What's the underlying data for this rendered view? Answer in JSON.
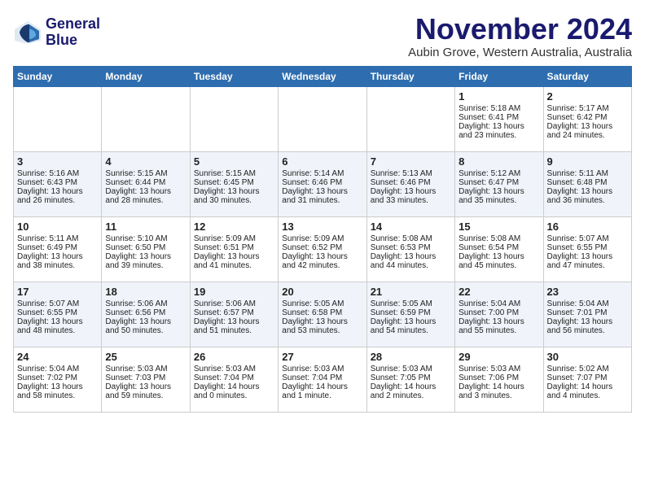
{
  "logo": {
    "line1": "General",
    "line2": "Blue"
  },
  "title": "November 2024",
  "location": "Aubin Grove, Western Australia, Australia",
  "days_header": [
    "Sunday",
    "Monday",
    "Tuesday",
    "Wednesday",
    "Thursday",
    "Friday",
    "Saturday"
  ],
  "weeks": [
    [
      {
        "day": "",
        "info": ""
      },
      {
        "day": "",
        "info": ""
      },
      {
        "day": "",
        "info": ""
      },
      {
        "day": "",
        "info": ""
      },
      {
        "day": "",
        "info": ""
      },
      {
        "day": "1",
        "info": "Sunrise: 5:18 AM\nSunset: 6:41 PM\nDaylight: 13 hours\nand 23 minutes."
      },
      {
        "day": "2",
        "info": "Sunrise: 5:17 AM\nSunset: 6:42 PM\nDaylight: 13 hours\nand 24 minutes."
      }
    ],
    [
      {
        "day": "3",
        "info": "Sunrise: 5:16 AM\nSunset: 6:43 PM\nDaylight: 13 hours\nand 26 minutes."
      },
      {
        "day": "4",
        "info": "Sunrise: 5:15 AM\nSunset: 6:44 PM\nDaylight: 13 hours\nand 28 minutes."
      },
      {
        "day": "5",
        "info": "Sunrise: 5:15 AM\nSunset: 6:45 PM\nDaylight: 13 hours\nand 30 minutes."
      },
      {
        "day": "6",
        "info": "Sunrise: 5:14 AM\nSunset: 6:46 PM\nDaylight: 13 hours\nand 31 minutes."
      },
      {
        "day": "7",
        "info": "Sunrise: 5:13 AM\nSunset: 6:46 PM\nDaylight: 13 hours\nand 33 minutes."
      },
      {
        "day": "8",
        "info": "Sunrise: 5:12 AM\nSunset: 6:47 PM\nDaylight: 13 hours\nand 35 minutes."
      },
      {
        "day": "9",
        "info": "Sunrise: 5:11 AM\nSunset: 6:48 PM\nDaylight: 13 hours\nand 36 minutes."
      }
    ],
    [
      {
        "day": "10",
        "info": "Sunrise: 5:11 AM\nSunset: 6:49 PM\nDaylight: 13 hours\nand 38 minutes."
      },
      {
        "day": "11",
        "info": "Sunrise: 5:10 AM\nSunset: 6:50 PM\nDaylight: 13 hours\nand 39 minutes."
      },
      {
        "day": "12",
        "info": "Sunrise: 5:09 AM\nSunset: 6:51 PM\nDaylight: 13 hours\nand 41 minutes."
      },
      {
        "day": "13",
        "info": "Sunrise: 5:09 AM\nSunset: 6:52 PM\nDaylight: 13 hours\nand 42 minutes."
      },
      {
        "day": "14",
        "info": "Sunrise: 5:08 AM\nSunset: 6:53 PM\nDaylight: 13 hours\nand 44 minutes."
      },
      {
        "day": "15",
        "info": "Sunrise: 5:08 AM\nSunset: 6:54 PM\nDaylight: 13 hours\nand 45 minutes."
      },
      {
        "day": "16",
        "info": "Sunrise: 5:07 AM\nSunset: 6:55 PM\nDaylight: 13 hours\nand 47 minutes."
      }
    ],
    [
      {
        "day": "17",
        "info": "Sunrise: 5:07 AM\nSunset: 6:55 PM\nDaylight: 13 hours\nand 48 minutes."
      },
      {
        "day": "18",
        "info": "Sunrise: 5:06 AM\nSunset: 6:56 PM\nDaylight: 13 hours\nand 50 minutes."
      },
      {
        "day": "19",
        "info": "Sunrise: 5:06 AM\nSunset: 6:57 PM\nDaylight: 13 hours\nand 51 minutes."
      },
      {
        "day": "20",
        "info": "Sunrise: 5:05 AM\nSunset: 6:58 PM\nDaylight: 13 hours\nand 53 minutes."
      },
      {
        "day": "21",
        "info": "Sunrise: 5:05 AM\nSunset: 6:59 PM\nDaylight: 13 hours\nand 54 minutes."
      },
      {
        "day": "22",
        "info": "Sunrise: 5:04 AM\nSunset: 7:00 PM\nDaylight: 13 hours\nand 55 minutes."
      },
      {
        "day": "23",
        "info": "Sunrise: 5:04 AM\nSunset: 7:01 PM\nDaylight: 13 hours\nand 56 minutes."
      }
    ],
    [
      {
        "day": "24",
        "info": "Sunrise: 5:04 AM\nSunset: 7:02 PM\nDaylight: 13 hours\nand 58 minutes."
      },
      {
        "day": "25",
        "info": "Sunrise: 5:03 AM\nSunset: 7:03 PM\nDaylight: 13 hours\nand 59 minutes."
      },
      {
        "day": "26",
        "info": "Sunrise: 5:03 AM\nSunset: 7:04 PM\nDaylight: 14 hours\nand 0 minutes."
      },
      {
        "day": "27",
        "info": "Sunrise: 5:03 AM\nSunset: 7:04 PM\nDaylight: 14 hours\nand 1 minute."
      },
      {
        "day": "28",
        "info": "Sunrise: 5:03 AM\nSunset: 7:05 PM\nDaylight: 14 hours\nand 2 minutes."
      },
      {
        "day": "29",
        "info": "Sunrise: 5:03 AM\nSunset: 7:06 PM\nDaylight: 14 hours\nand 3 minutes."
      },
      {
        "day": "30",
        "info": "Sunrise: 5:02 AM\nSunset: 7:07 PM\nDaylight: 14 hours\nand 4 minutes."
      }
    ]
  ]
}
